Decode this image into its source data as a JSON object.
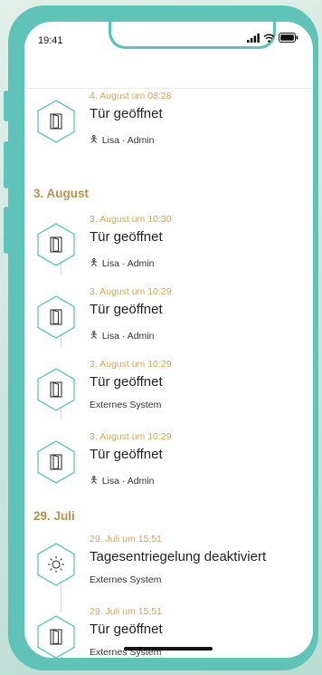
{
  "status": {
    "time": "19:41"
  },
  "colors": {
    "accent_teal": "#5fc3b8",
    "date_gold": "#b69150",
    "time_gold": "#c9a86a"
  },
  "timeline": {
    "entries": [
      {
        "time": "4. August um 08:28",
        "title": "Tür geöffnet",
        "subtitle": "Lisa · Admin",
        "icon": "door-icon",
        "has_user_icon": true
      },
      {
        "time": "3. August um 10:30",
        "title": "Tür geöffnet",
        "subtitle": "Lisa · Admin",
        "icon": "door-icon",
        "has_user_icon": true
      },
      {
        "time": "3. August um 10:29",
        "title": "Tür geöffnet",
        "subtitle": "Lisa · Admin",
        "icon": "door-icon",
        "has_user_icon": true
      },
      {
        "time": "3. August um 10:29",
        "title": "Tür geöffnet",
        "subtitle": "Externes System",
        "icon": "door-icon",
        "has_user_icon": false
      },
      {
        "time": "3. August um 10:29",
        "title": "Tür geöffnet",
        "subtitle": "Lisa · Admin",
        "icon": "door-icon",
        "has_user_icon": true
      },
      {
        "time": "29. Juli um 15:51",
        "title": "Tagesentriegelung deaktiviert",
        "subtitle": "Externes System",
        "icon": "sun-icon",
        "has_user_icon": false
      },
      {
        "time": "29. Juli um 15:51",
        "title": "Tür geöffnet",
        "subtitle": "Externes System",
        "icon": "door-icon",
        "has_user_icon": false
      }
    ],
    "date_headers": [
      "3. August",
      "29. Juli"
    ]
  }
}
